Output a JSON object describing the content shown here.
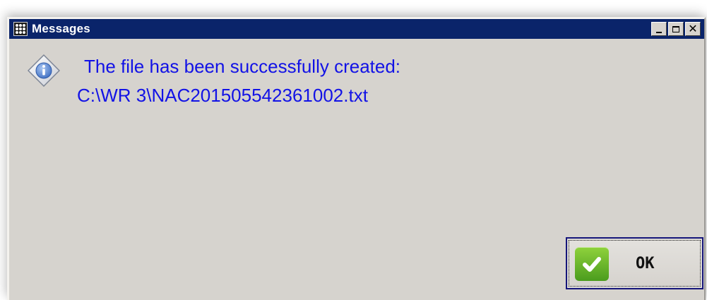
{
  "window": {
    "title": "Messages",
    "controls": {
      "minimize": "minimize",
      "maximize": "maximize",
      "close": "close"
    }
  },
  "message": {
    "icon": "info-diamond-icon",
    "line1": "The file has been successfully created:",
    "line2": "C:\\WR 3\\NAC201505542361002.txt",
    "text_color": "#1212e6"
  },
  "buttons": {
    "ok_label": "OK",
    "ok_icon": "checkmark-icon"
  },
  "colors": {
    "titlebar": "#0a246a",
    "dialog_bg": "#d6d3ce",
    "ok_icon_green": "#5cb02a"
  }
}
